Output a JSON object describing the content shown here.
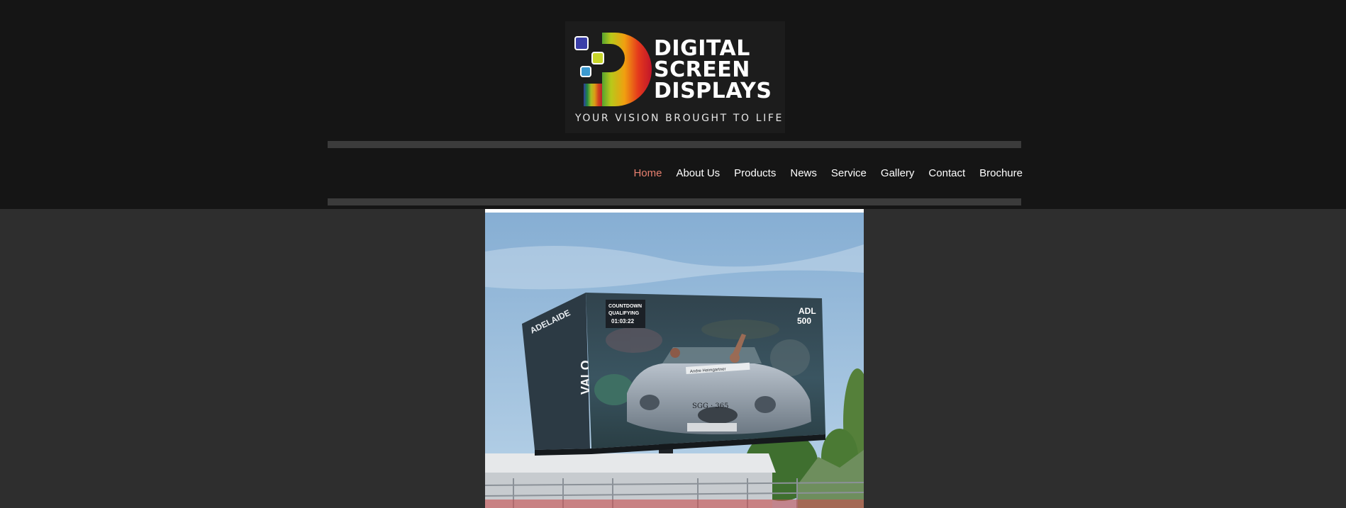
{
  "site": {
    "brand_lines": [
      "DIGITAL",
      "SCREEN",
      "DISPLAYS"
    ],
    "tagline": "YOUR VISION BROUGHT TO LIFE"
  },
  "nav": {
    "items": [
      {
        "label": "Home",
        "active": true
      },
      {
        "label": "About Us",
        "active": false
      },
      {
        "label": "Products",
        "active": false
      },
      {
        "label": "News",
        "active": false
      },
      {
        "label": "Service",
        "active": false
      },
      {
        "label": "Gallery",
        "active": false
      },
      {
        "label": "Contact",
        "active": false
      },
      {
        "label": "Brochure",
        "active": false
      }
    ]
  },
  "hero": {
    "screen_left_text": "ADELAIDE",
    "screen_badge_lines": [
      "COUNTDOWN",
      "QUALIFYING",
      "01:03:22"
    ],
    "screen_logo_lines": [
      "ADL",
      "500"
    ],
    "screen_side_text": "VALO",
    "car_plate": "SGG · 365",
    "driver_banner": "Andre Heimgartner"
  },
  "colors": {
    "header_bg": "#151515",
    "page_bg": "#2e2e2e",
    "nav_active": "#e8806f",
    "nav_text": "#ffffff"
  }
}
